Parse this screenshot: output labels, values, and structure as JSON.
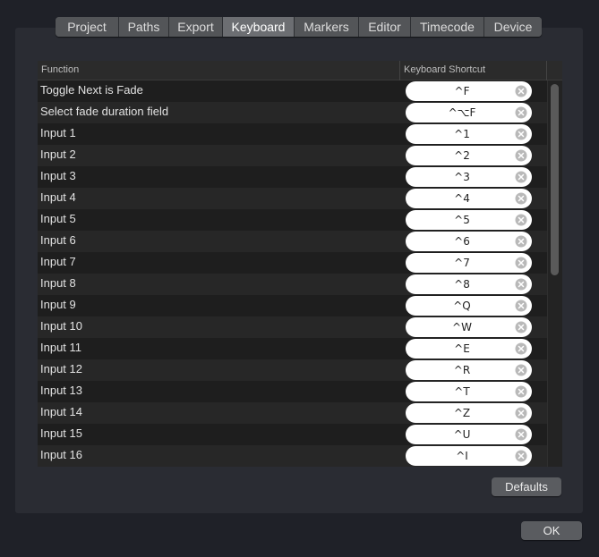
{
  "tabs": [
    {
      "label": "Project",
      "width": 70
    },
    {
      "label": "Paths",
      "width": 56
    },
    {
      "label": "Export",
      "width": 60
    },
    {
      "label": "Keyboard",
      "width": 80,
      "active": true
    },
    {
      "label": "Markers",
      "width": 72
    },
    {
      "label": "Editor",
      "width": 58
    },
    {
      "label": "Timecode",
      "width": 82
    },
    {
      "label": "Device",
      "width": 65
    }
  ],
  "table": {
    "header_function": "Function",
    "header_shortcut": "Keyboard Shortcut",
    "rows": [
      {
        "function": "Toggle Next is Fade",
        "shortcut": "^F"
      },
      {
        "function": "Select fade duration field",
        "shortcut": "^⌥F"
      },
      {
        "function": "Input 1",
        "shortcut": "^1"
      },
      {
        "function": "Input 2",
        "shortcut": "^2"
      },
      {
        "function": "Input 3",
        "shortcut": "^3"
      },
      {
        "function": "Input 4",
        "shortcut": "^4"
      },
      {
        "function": "Input 5",
        "shortcut": "^5"
      },
      {
        "function": "Input 6",
        "shortcut": "^6"
      },
      {
        "function": "Input 7",
        "shortcut": "^7"
      },
      {
        "function": "Input 8",
        "shortcut": "^8"
      },
      {
        "function": "Input 9",
        "shortcut": "^Q"
      },
      {
        "function": "Input 10",
        "shortcut": "^W"
      },
      {
        "function": "Input 11",
        "shortcut": "^E"
      },
      {
        "function": "Input 12",
        "shortcut": "^R"
      },
      {
        "function": "Input 13",
        "shortcut": "^T"
      },
      {
        "function": "Input 14",
        "shortcut": "^Z"
      },
      {
        "function": "Input 15",
        "shortcut": "^U"
      },
      {
        "function": "Input 16",
        "shortcut": "^I"
      }
    ]
  },
  "buttons": {
    "defaults": "Defaults",
    "ok": "OK"
  },
  "colors": {
    "background": "#1f2128",
    "panel": "#2a2c33",
    "tab_active": "#6c6e72",
    "tab_inactive": "#535558"
  }
}
